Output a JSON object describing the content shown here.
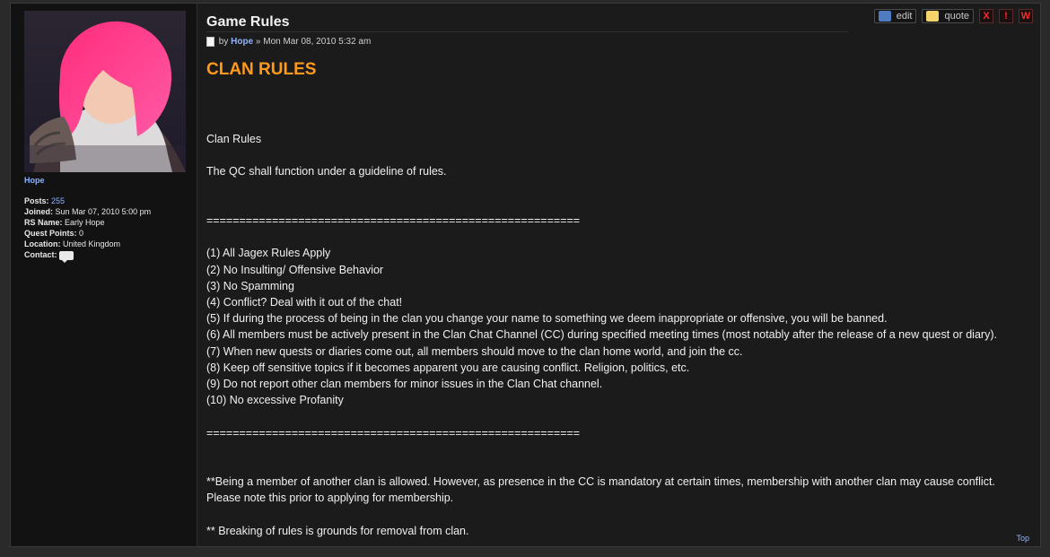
{
  "profile": {
    "username": "Hope",
    "posts_label": "Posts:",
    "posts_value": "255",
    "joined_label": "Joined:",
    "joined_value": "Sun Mar 07, 2010 5:00 pm",
    "rsname_label": "RS Name:",
    "rsname_value": "Early Hope",
    "questpoints_label": "Quest Points:",
    "questpoints_value": "0",
    "location_label": "Location:",
    "location_value": "United Kingdom",
    "contact_label": "Contact:",
    "avatar_icon": "avatar-photo"
  },
  "post": {
    "title": "Game Rules",
    "meta_by": "by",
    "meta_author": "Hope",
    "meta_sep": "»",
    "meta_date": "Mon Mar 08, 2010 5:32 am",
    "heading": "CLAN RULES",
    "body": "Clan Rules\n\nThe QC shall function under a guideline of rules.\n\n\n=========================================================\n\n(1) All Jagex Rules Apply\n(2) No Insulting/ Offensive Behavior\n(3) No Spamming\n(4) Conflict? Deal with it out of the chat!\n(5) If during the process of being in the clan you change your name to something we deem inappropriate or offensive, you will be banned.\n(6) All members must be actively present in the Clan Chat Channel (CC) during specified meeting times (most notably after the release of a new quest or diary).\n(7) When new quests or diaries come out, all members should move to the clan home world, and join the cc.\n(8) Keep off sensitive topics if it becomes apparent you are causing conflict. Religion, politics, etc.\n(9) Do not report other clan members for minor issues in the Clan Chat channel.\n(10) No excessive Profanity\n\n=========================================================\n\n\n**Being a member of another clan is allowed. However, as presence in the CC is mandatory at certain times, membership with another clan may cause conflict.\nPlease note this prior to applying for membership.\n\n** Breaking of rules is grounds for removal from clan.",
    "actions": {
      "edit": "edit",
      "quote": "quote",
      "delete": "X",
      "report": "!",
      "warn": "W"
    },
    "top_link": "Top"
  },
  "colors": {
    "heading": "#ff9a1a",
    "link": "#8fb3ff",
    "danger": "#ff2a2a"
  }
}
